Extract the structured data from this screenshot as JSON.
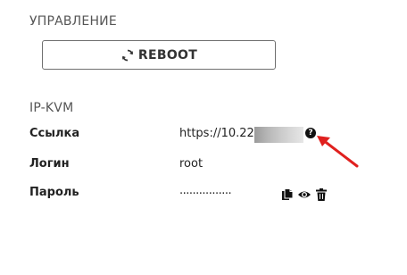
{
  "management": {
    "title": "УПРАВЛЕНИЕ",
    "reboot_label": "REBOOT"
  },
  "ipkvm": {
    "title": "IP-KVM",
    "link_label": "Ссылка",
    "link_value": "https://10.22.",
    "login_label": "Логин",
    "login_value": "root",
    "password_label": "Пароль",
    "password_value": "................"
  },
  "icons": {
    "reboot": "refresh-icon",
    "help": "question-circle-icon",
    "copy": "copy-icon",
    "show": "eye-icon",
    "delete": "trash-icon"
  },
  "colors": {
    "annotation_arrow": "#e0201e"
  }
}
